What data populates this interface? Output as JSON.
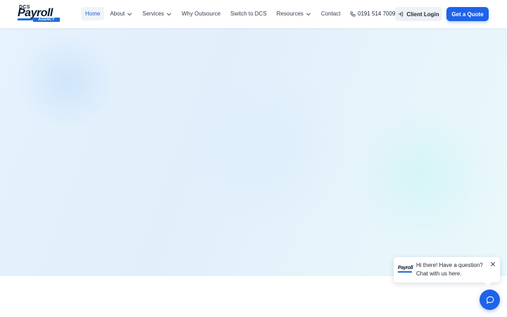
{
  "brand": {
    "logo_top": "DCS",
    "logo_main": "Payroll",
    "logo_sub": "AGENCY"
  },
  "nav": {
    "items": [
      {
        "label": "Home",
        "active": true,
        "dropdown": false
      },
      {
        "label": "About",
        "active": false,
        "dropdown": true
      },
      {
        "label": "Services",
        "active": false,
        "dropdown": true
      },
      {
        "label": "Why Outsource",
        "active": false,
        "dropdown": false
      },
      {
        "label": "Switch to DCS",
        "active": false,
        "dropdown": false
      },
      {
        "label": "Resources",
        "active": false,
        "dropdown": true
      },
      {
        "label": "Contact",
        "active": false,
        "dropdown": false
      }
    ]
  },
  "header": {
    "phone": "0191 514 7009",
    "client_login": "Client Login",
    "cta": "Get a Quote"
  },
  "chat": {
    "logo_text": "Payroll",
    "line1": "Hi there! Have a question?",
    "line2": "Chat with us here."
  },
  "colors": {
    "accent": "#1e63e9",
    "nav_active_bg": "#eef4fc",
    "nav_active_text": "#1f5fbf",
    "brand_dark": "#0b1b33"
  },
  "icons": {
    "phone": "phone-icon",
    "login": "login-icon",
    "chevron": "chevron-down-icon",
    "close": "close-icon",
    "chat": "chat-bubble-icon"
  }
}
